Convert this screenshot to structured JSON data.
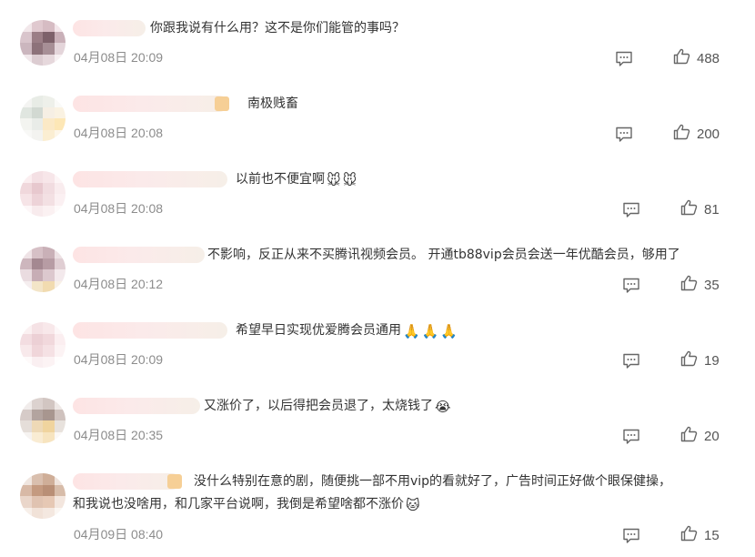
{
  "comments": [
    {
      "text": "你跟我说有什么用？这不是你们能管的事吗？",
      "time": "04月08日 20:09",
      "likes": "488",
      "avatar_colors": [
        "#f2e7ea",
        "#e0c9cf",
        "#d6bcc3",
        "#f3e6ea",
        "#d9c5cc",
        "#9b7e86",
        "#7d616a",
        "#c9b0b8",
        "#cbb6be",
        "#8d727a",
        "#a78f96",
        "#e4d5da",
        "#f1e8eb",
        "#dcccd1",
        "#e6d8dc",
        "#f7f0f2"
      ]
    },
    {
      "text": "南极贱畜",
      "time": "04月08日 20:08",
      "likes": "200",
      "avatar_colors": [
        "#f4f4f2",
        "#e8ece6",
        "#eef0ea",
        "#fafaf8",
        "#e0e6e0",
        "#d2d9d2",
        "#f6efe4",
        "#faf2e2",
        "#f3f4f0",
        "#e9ece8",
        "#fbe9c6",
        "#fde7b6",
        "#f8f8f6",
        "#f3f3f0",
        "#fbeed2",
        "#fdf6e8"
      ]
    },
    {
      "text": "以前也不便宜啊",
      "emojis": [
        "🐭",
        "🐭"
      ],
      "time": "04月08日 20:08",
      "likes": "81",
      "avatar_colors": [
        "#fbeef0",
        "#f4e0e4",
        "#f7e6e9",
        "#fdf5f6",
        "#f0d8dc",
        "#e7c8ce",
        "#f1dce0",
        "#f9ecee",
        "#f6e4e7",
        "#edd3d8",
        "#f3e0e3",
        "#fbf0f2",
        "#fdf7f8",
        "#f8ebed",
        "#fbf1f2",
        "#fefafa"
      ]
    },
    {
      "text": "不影响，反正从来不买腾讯视频会员。 开通tb88vip会员会送一年优酷会员，够用了",
      "time": "04月08日 20:12",
      "likes": "35",
      "avatar_colors": [
        "#efe3e6",
        "#d6c0c6",
        "#c9b0b7",
        "#ede1e4",
        "#cdb6bd",
        "#a48891",
        "#b79ca4",
        "#e0ced3",
        "#eadce0",
        "#c7adb5",
        "#dcc8ce",
        "#f3e9ec",
        "#f5eeef",
        "#f3e5c8",
        "#f1dbb0",
        "#f8f0e6"
      ]
    },
    {
      "text": "希望早日实现优爱腾会员通用",
      "emojis": [
        "🙏",
        "🙏",
        "🙏"
      ],
      "time": "04月08日 20:09",
      "likes": "19",
      "avatar_colors": [
        "#fbf1f2",
        "#f5e2e5",
        "#f8e8ea",
        "#fdf7f8",
        "#f3dde1",
        "#ecd0d5",
        "#f1d8dc",
        "#fbeef0",
        "#f8e9eb",
        "#f0d6da",
        "#f5e1e4",
        "#fcf3f4",
        "#fefafa",
        "#faeff1",
        "#fcf3f4",
        "#fffdfd"
      ]
    },
    {
      "text": "又涨价了，以后得把会员退了，太烧钱了",
      "emojis": [
        "😭"
      ],
      "time": "04月08日 20:35",
      "likes": "20",
      "avatar_colors": [
        "#f1eceb",
        "#dcd2cf",
        "#d2c6c2",
        "#eee8e6",
        "#d6cbc8",
        "#b3a49f",
        "#a8968f",
        "#cfc2be",
        "#e5ded9",
        "#eed9b6",
        "#f0d49e",
        "#e8e2dd",
        "#f6f3f1",
        "#f9ecd3",
        "#f7e4bf",
        "#fbf8f5"
      ]
    },
    {
      "text": "没什么特别在意的剧，随便挑一部不用vip的看就好了，广告时间正好做个眼保健操，",
      "text2": "和我说也没啥用，和几家平台说啊，我倒是希望啥都不涨价",
      "emojis": [
        "🐱"
      ],
      "time": "04月09日 08:40",
      "likes": "15",
      "avatar_colors": [
        "#f0e6e0",
        "#d9bfae",
        "#cfae98",
        "#efe3dc",
        "#d8b9a6",
        "#c49a80",
        "#b98f76",
        "#d7bca9",
        "#ead6ca",
        "#e0c3b1",
        "#e6c8b4",
        "#f3e6de",
        "#f7efe9",
        "#f1e2d8",
        "#f4e8e0",
        "#fbf6f2"
      ]
    }
  ]
}
